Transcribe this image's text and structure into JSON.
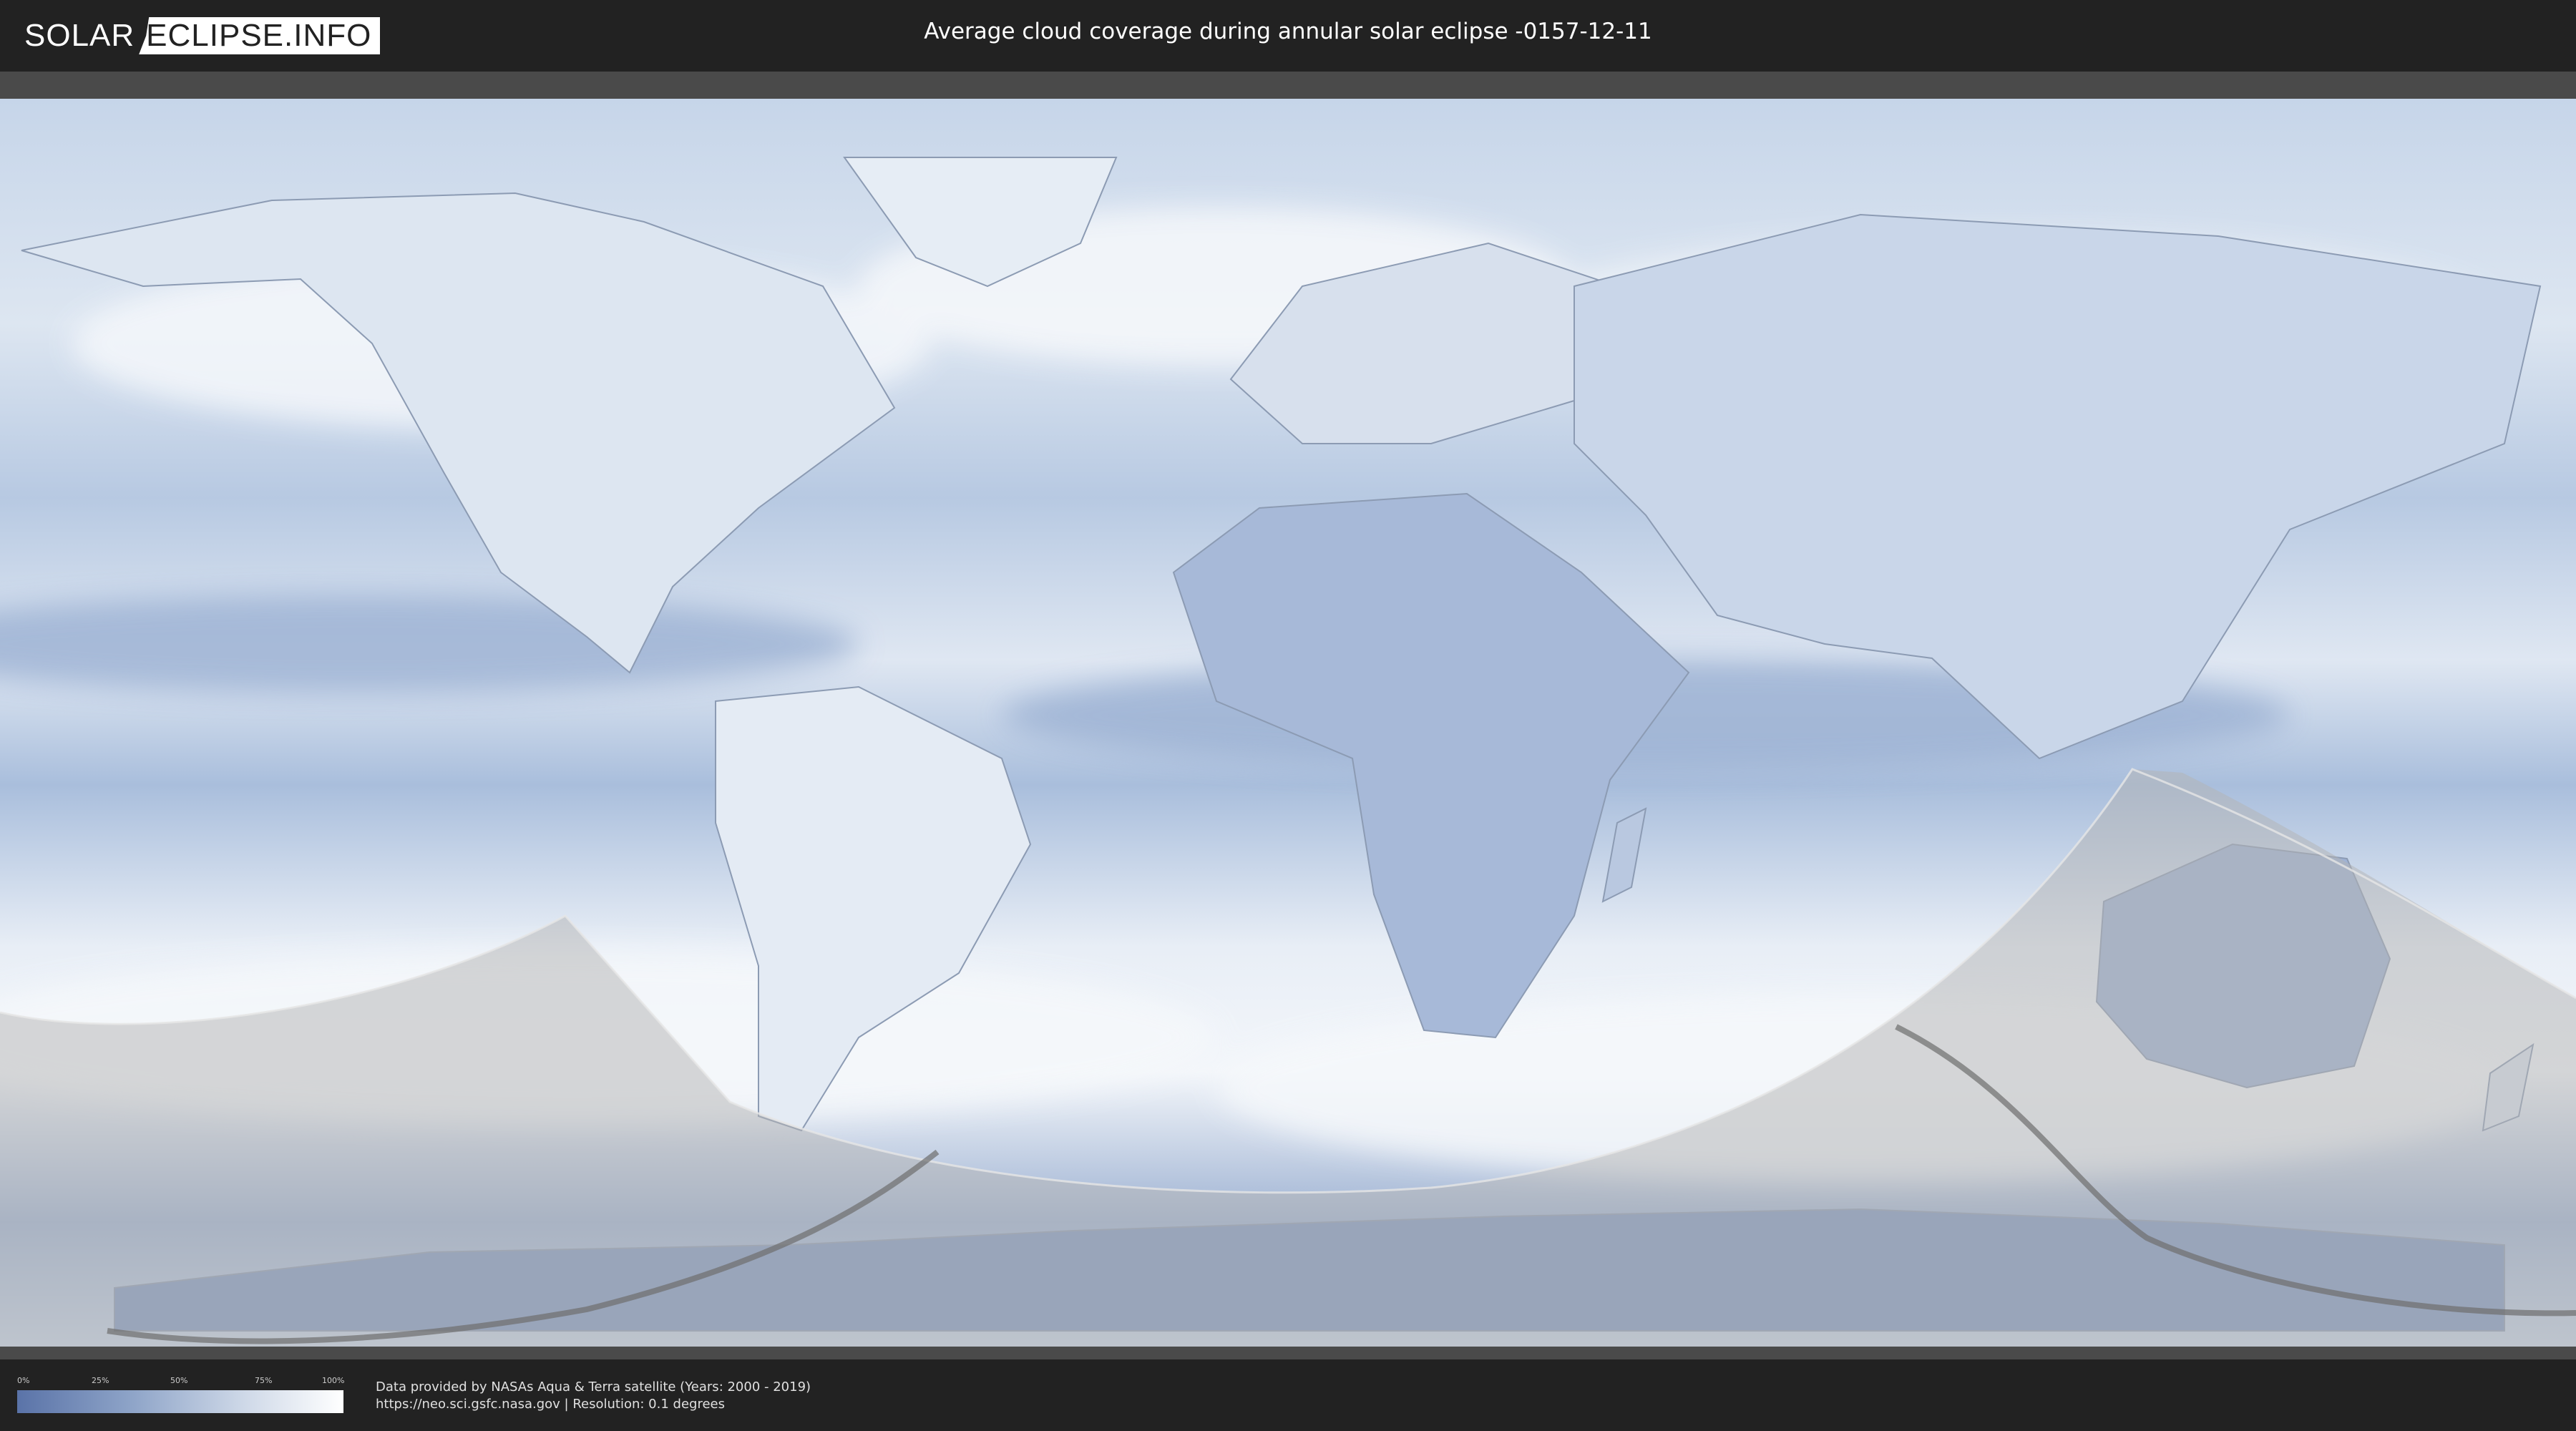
{
  "header": {
    "logo_part1": "SOLAR",
    "logo_part2": "ECLIPSE.INFO",
    "title": "Average cloud coverage during annular solar eclipse -0157-12-11"
  },
  "legend": {
    "ticks": [
      "0%",
      "25%",
      "50%",
      "75%",
      "100%"
    ],
    "colors": {
      "low": "#5a73a8",
      "mid": "#cfd9e8",
      "high": "#ffffff"
    }
  },
  "footer": {
    "credit_line1": "Data provided by NASAs Aqua & Terra satellite (Years: 2000 - 2019)",
    "credit_line2": "https://neo.sci.gsfc.nasa.gov | Resolution: 0.1 degrees"
  },
  "map": {
    "projection": "equirectangular world map",
    "layers": [
      "cloud-coverage",
      "country-borders",
      "night-shading",
      "eclipse-path"
    ],
    "colors": {
      "cloud_clear": "#ffffff",
      "cloud_dense": "#6d87b6",
      "night_shade": "#bdbdbd"
    }
  }
}
